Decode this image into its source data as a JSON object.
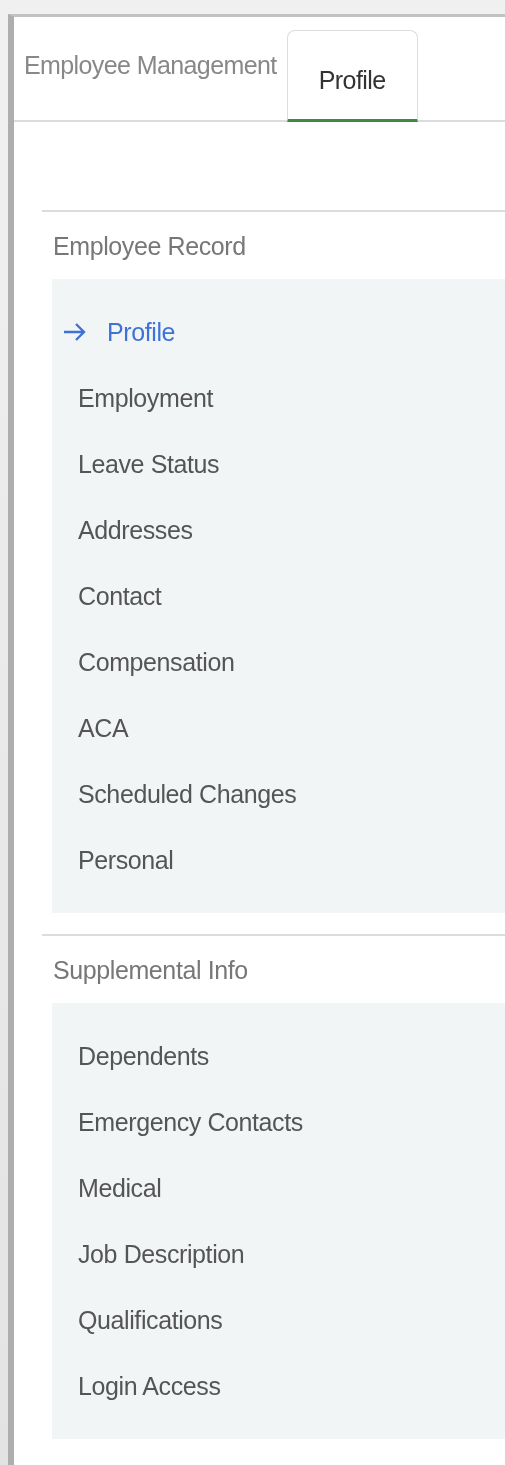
{
  "tabs": [
    {
      "label": "Employee Management",
      "selected": false
    },
    {
      "label": "Profile",
      "selected": true
    }
  ],
  "sections": [
    {
      "title": "Employee Record",
      "items": [
        {
          "label": "Profile",
          "selected": true
        },
        {
          "label": "Employment",
          "selected": false
        },
        {
          "label": "Leave Status",
          "selected": false
        },
        {
          "label": "Addresses",
          "selected": false
        },
        {
          "label": "Contact",
          "selected": false
        },
        {
          "label": "Compensation",
          "selected": false
        },
        {
          "label": "ACA",
          "selected": false
        },
        {
          "label": "Scheduled Changes",
          "selected": false
        },
        {
          "label": "Personal",
          "selected": false
        }
      ]
    },
    {
      "title": "Supplemental Info",
      "items": [
        {
          "label": "Dependents",
          "selected": false
        },
        {
          "label": "Emergency Contacts",
          "selected": false
        },
        {
          "label": "Medical",
          "selected": false
        },
        {
          "label": "Job Description",
          "selected": false
        },
        {
          "label": "Qualifications",
          "selected": false
        },
        {
          "label": "Login Access",
          "selected": false
        }
      ]
    }
  ]
}
